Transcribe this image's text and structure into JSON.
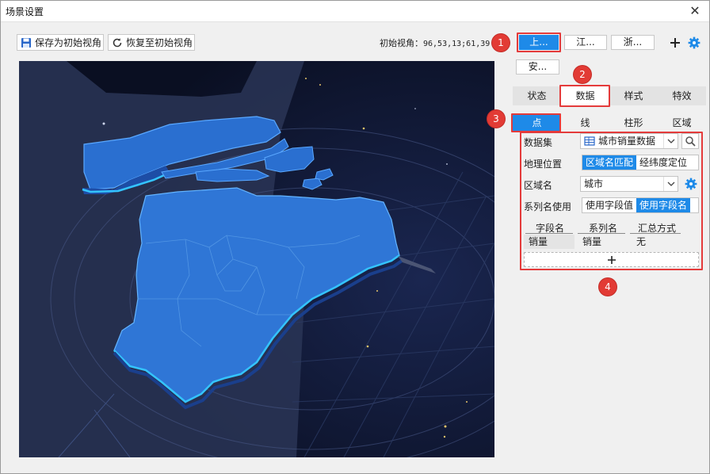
{
  "window": {
    "title": "场景设置",
    "close_glyph": "✕"
  },
  "toolbar": {
    "save_initial_view": "保存为初始视角",
    "restore_initial_view": "恢复至初始视角",
    "initial_view_label": "初始视角：",
    "initial_view_value": "96,53,13;61,39"
  },
  "view_buttons": [
    "上...",
    "江...",
    "浙...",
    "安..."
  ],
  "tabs": [
    "状态",
    "数据",
    "样式",
    "特效"
  ],
  "subtabs": [
    "点",
    "线",
    "柱形",
    "区域"
  ],
  "form": {
    "dataset_label": "数据集",
    "dataset_value": "城市销量数据",
    "geo_label": "地理位置",
    "geo_options": [
      "区域名匹配",
      "经纬度定位"
    ],
    "region_label": "区域名",
    "region_value": "城市",
    "series_label": "系列名使用",
    "series_options": [
      "使用字段值",
      "使用字段名"
    ],
    "grid_headers": [
      "字段名",
      "系列名",
      "汇总方式"
    ],
    "grid_row": [
      "销量",
      "销量",
      "无"
    ],
    "add_glyph": "+"
  },
  "badges": [
    "1",
    "2",
    "3",
    "4"
  ],
  "icons": [
    "save-icon",
    "refresh-icon",
    "plus-icon",
    "gear-icon",
    "search-icon",
    "chevron-down-icon",
    "table-icon"
  ],
  "colors": {
    "accent": "#1e8ae8",
    "highlight": "#e43b3b",
    "map_bg": "#0c1229",
    "map_fill": "#2a6fd0"
  }
}
